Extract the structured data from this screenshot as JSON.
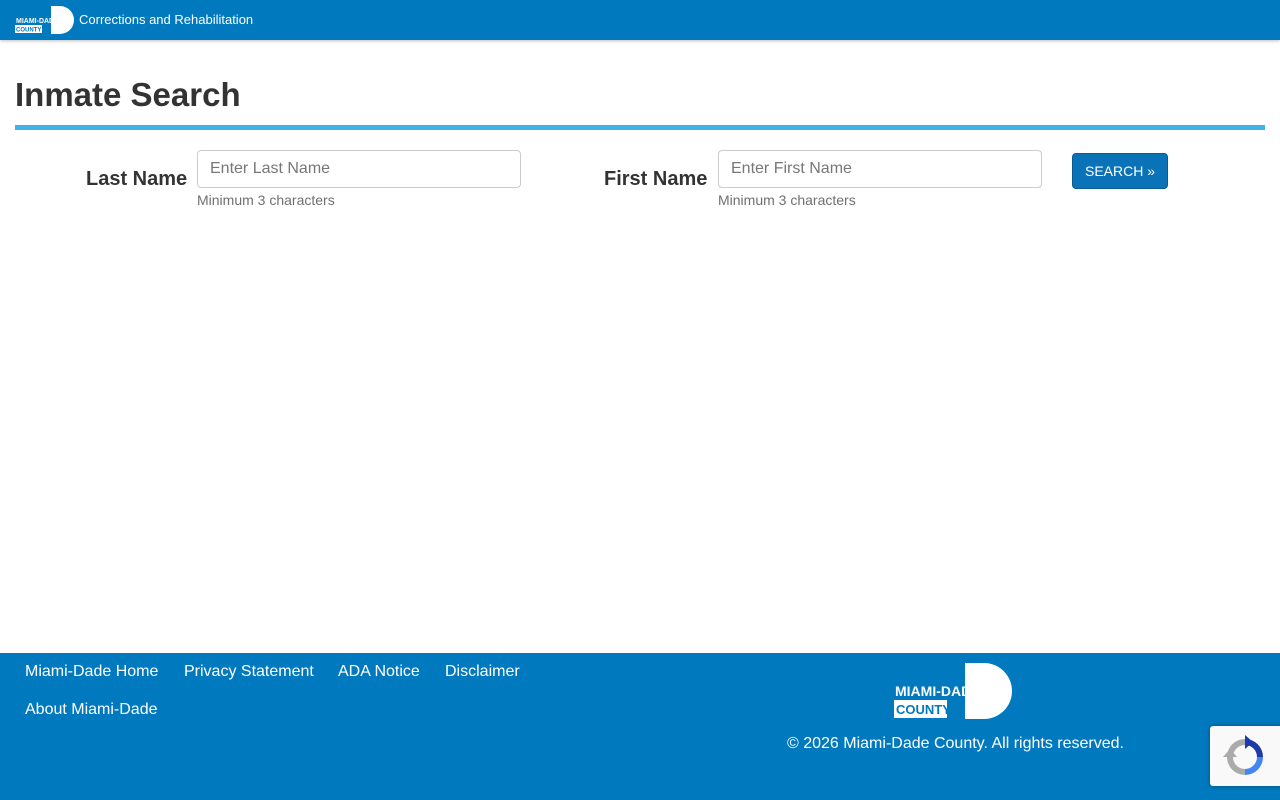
{
  "header": {
    "logo_text_top": "MIAMI-DADE",
    "logo_text_bottom": "COUNTY",
    "department": "Corrections and Rehabilitation"
  },
  "page": {
    "title": "Inmate Search"
  },
  "form": {
    "last_name": {
      "label": "Last Name",
      "placeholder": "Enter Last Name",
      "value": "",
      "hint": "Minimum 3 characters"
    },
    "first_name": {
      "label": "First Name",
      "placeholder": "Enter First Name",
      "value": "",
      "hint": "Minimum 3 characters"
    },
    "search_label": "SEARCH »"
  },
  "footer": {
    "links": [
      "Miami-Dade Home",
      "Privacy Statement",
      "ADA Notice",
      "Disclaimer",
      "About Miami-Dade"
    ],
    "logo_text_top": "MIAMI-DADE",
    "logo_text_bottom": "COUNTY",
    "copyright": "© 2026 Miami-Dade County. All rights reserved."
  },
  "icons": {
    "header_logo": "miami-dade-logo",
    "footer_logo": "miami-dade-logo",
    "recaptcha": "recaptcha-icon"
  },
  "colors": {
    "brand_blue": "#0079be",
    "accent_rule": "#3fb3e6",
    "button": "#0a73b7"
  }
}
